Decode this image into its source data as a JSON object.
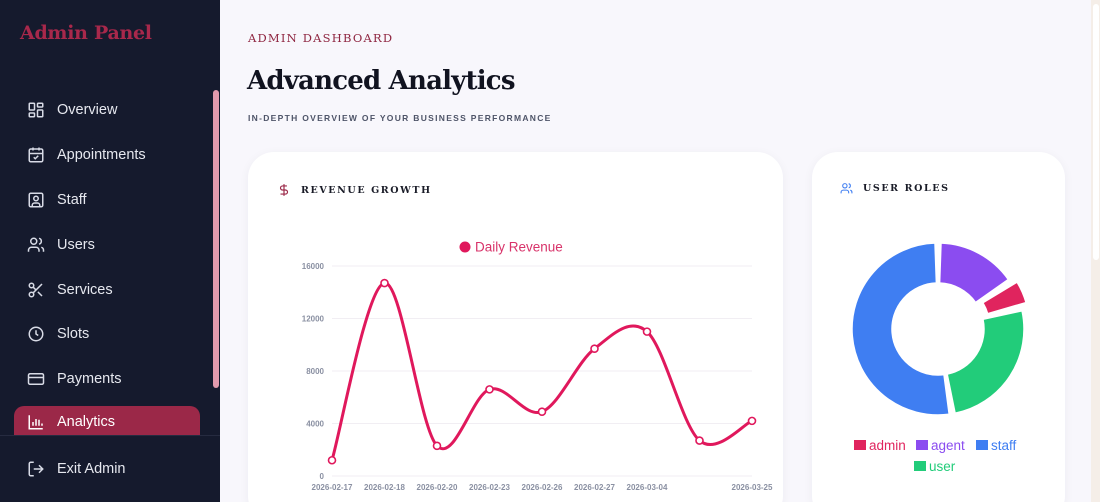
{
  "sidebar": {
    "brand": "Admin Panel",
    "items": [
      {
        "label": "Overview",
        "icon": "grid-icon"
      },
      {
        "label": "Appointments",
        "icon": "calendar-check-icon"
      },
      {
        "label": "Staff",
        "icon": "id-badge-icon"
      },
      {
        "label": "Users",
        "icon": "users-icon"
      },
      {
        "label": "Services",
        "icon": "scissors-icon"
      },
      {
        "label": "Slots",
        "icon": "clock-icon"
      },
      {
        "label": "Payments",
        "icon": "credit-card-icon"
      },
      {
        "label": "Analytics",
        "icon": "bar-chart-icon",
        "active": true
      }
    ],
    "exit_label": "Exit Admin"
  },
  "header": {
    "eyebrow": "ADMIN DASHBOARD",
    "title": "Advanced Analytics",
    "subtitle": "IN-DEPTH OVERVIEW OF YOUR BUSINESS PERFORMANCE"
  },
  "revenue_card": {
    "title": "REVENUE GROWTH",
    "icon": "dollar-icon"
  },
  "roles_card": {
    "title": "USER ROLES",
    "icon": "users-icon"
  },
  "colors": {
    "accent": "#9b2848",
    "line": "#e0185c",
    "admin": "#e0245e",
    "agent": "#8b4cf0",
    "staff": "#3f7ef2",
    "user": "#22cc7a"
  },
  "chart_data": [
    {
      "type": "line",
      "series": [
        {
          "name": "Daily Revenue",
          "x": [
            "2026-02-17",
            "2026-02-18",
            "2026-02-20",
            "2026-02-23",
            "2026-02-26",
            "2026-02-27",
            "2026-03-04",
            "2026-03-12",
            "2026-03-25"
          ],
          "values": [
            1200,
            14700,
            2300,
            6600,
            4900,
            9700,
            11000,
            2700,
            4200
          ]
        }
      ],
      "x_tick_labels": [
        "2026-02-17",
        "2026-02-18",
        "2026-02-20",
        "2026-02-23",
        "2026-02-26",
        "2026-02-27",
        "2026-03-04",
        "2026-03-25"
      ],
      "y_ticks": [
        0,
        4000,
        8000,
        12000,
        16000
      ],
      "ylim": [
        0,
        16000
      ],
      "legend": "top"
    },
    {
      "type": "pie",
      "style": "doughnut",
      "categories": [
        "admin",
        "agent",
        "staff",
        "user"
      ],
      "values": [
        1,
        3,
        10,
        5
      ],
      "legend": "bottom"
    }
  ]
}
